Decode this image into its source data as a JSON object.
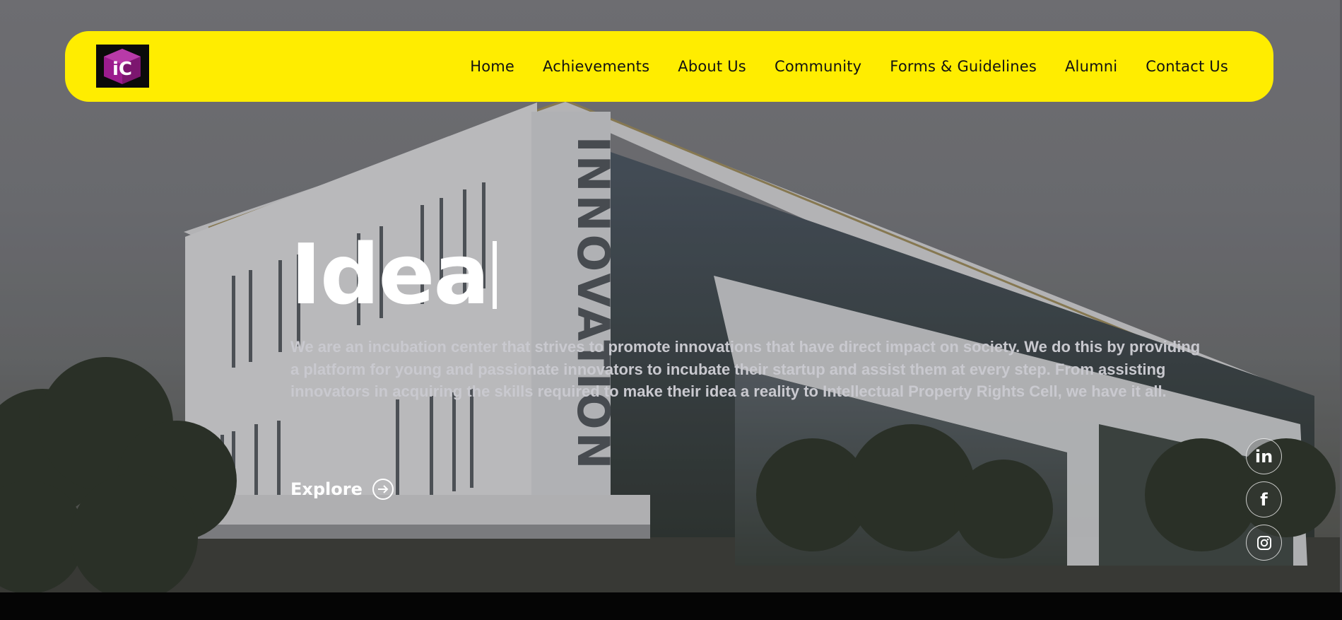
{
  "nav": {
    "logo_text": "iC",
    "links": [
      {
        "label": "Home"
      },
      {
        "label": "Achievements"
      },
      {
        "label": "About Us"
      },
      {
        "label": "Community"
      },
      {
        "label": "Forms & Guidelines"
      },
      {
        "label": "Alumni"
      },
      {
        "label": "Contact Us"
      }
    ]
  },
  "hero": {
    "headline": "Idea",
    "building_sign": "INNOVATION",
    "description": "We are an incubation center that strives to promote innovations that have direct impact on society. We do this by providing a platform for young and passionate innovators to incubate their startup and assist them at every step. From assisting innovators in acquiring the skills required to make their idea a reality to Intellectual Property Rights Cell, we have it all.",
    "cta_label": "Explore",
    "cta_icon": "arrow-right-circle-icon"
  },
  "social": {
    "linkedin_glyph": "in",
    "facebook_glyph": "f",
    "instagram_icon": "instagram-icon"
  },
  "colors": {
    "navbar_bg": "#ffed00",
    "nav_text": "#121212",
    "logo_purple": "#9b1c8e",
    "logo_bg": "#0a0a0a",
    "headline": "#ffffff",
    "description": "#c9c9cf"
  }
}
